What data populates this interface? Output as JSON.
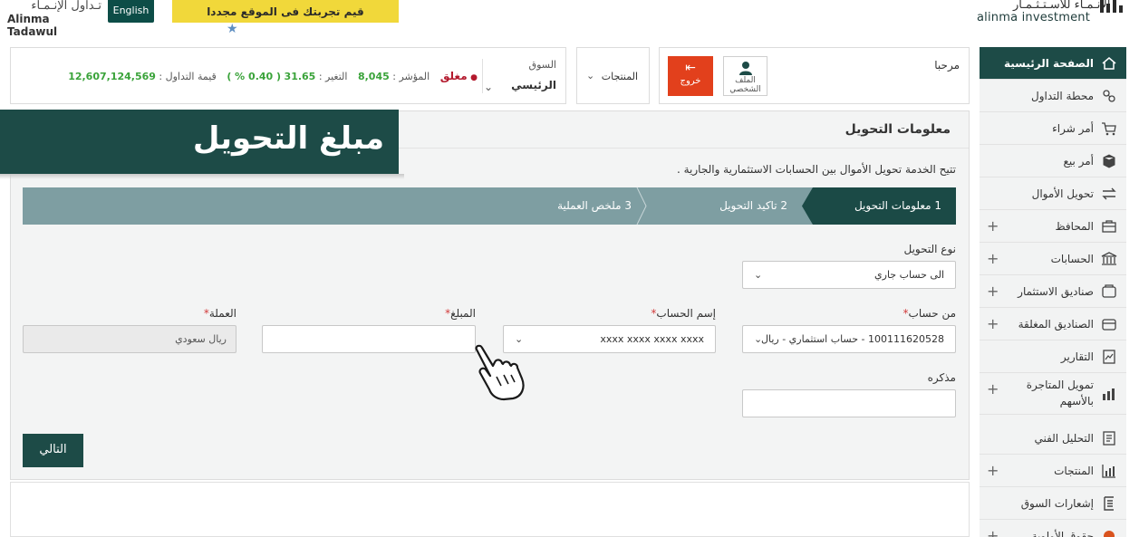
{
  "header": {
    "left_logo_ar": "تـداول الإنـمـاء",
    "left_logo_en": "Alinma Tadawul",
    "lang_button": "English",
    "promo_text": "قيم تجربتك فى الموقع مجددا",
    "right_logo_ar": "الإنـمـاء للاسـتـثـمـار",
    "right_logo_en": "alinma investment"
  },
  "market": {
    "label": "السوق",
    "value": "الرئيسي",
    "status": "مغلق",
    "index_label": "المؤشر :",
    "index_value": "8,045",
    "change_label": "التغير :",
    "change_value": "31.65",
    "change_pct": "( 0.40 % )",
    "turnover_label": "قيمة التداول :",
    "turnover_value": "12,607,124,569"
  },
  "products_menu": {
    "label": "المنتجات"
  },
  "user": {
    "welcome": "مرحبا",
    "profile_label": "الملف الشخصي",
    "logout_label": "خروج"
  },
  "page": {
    "title": "معلومات التحويل",
    "description": "تتيح الخدمة تحويل الأموال بين الحسابات الاستثمارية والجارية .",
    "overlay_caption": "مبلغ التحويل"
  },
  "steps": [
    {
      "label": "1 معلومات التحويل"
    },
    {
      "label": "2 تاكيد التحويل"
    },
    {
      "label": "3 ملخص العملية"
    }
  ],
  "form": {
    "transfer_type": {
      "label": "نوع التحويل",
      "value": "الى حساب جاري"
    },
    "from_account": {
      "label": "من حساب",
      "value": "100111620528 - حساب استثماري - ريال"
    },
    "account_name": {
      "label": "إسم الحساب",
      "value": "xxxx xxxx xxxx xxxx"
    },
    "amount": {
      "label": "المبلغ",
      "value": ""
    },
    "currency": {
      "label": "العملة",
      "value": "ريال سعودي"
    },
    "memo": {
      "label": "مذكره",
      "value": ""
    },
    "required_mark": "*",
    "next_button": "التالي"
  },
  "sidebar": {
    "items": [
      {
        "label": "الصفحة الرئيسية",
        "icon": "home-icon",
        "active": true,
        "expandable": false
      },
      {
        "label": "محطة التداول",
        "icon": "trading-station-icon",
        "active": false,
        "expandable": false
      },
      {
        "label": "أمر شراء",
        "icon": "cart-icon",
        "active": false,
        "expandable": false
      },
      {
        "label": "أمر بيع",
        "icon": "box-icon",
        "active": false,
        "expandable": false
      },
      {
        "label": "تحويل الأموال",
        "icon": "transfer-arrows-icon",
        "active": false,
        "expandable": false
      },
      {
        "label": "المحافظ",
        "icon": "briefcase-icon",
        "active": false,
        "expandable": true
      },
      {
        "label": "الحسابات",
        "icon": "bank-icon",
        "active": false,
        "expandable": true
      },
      {
        "label": "صناديق الاستثمار",
        "icon": "fund-icon",
        "active": false,
        "expandable": true
      },
      {
        "label": "الصناديق المغلقة",
        "icon": "closed-fund-icon",
        "active": false,
        "expandable": true
      },
      {
        "label": "التقارير",
        "icon": "reports-icon",
        "active": false,
        "expandable": false
      },
      {
        "label": "تمويل المتاجرة بالأسهم",
        "icon": "margin-finance-icon",
        "active": false,
        "expandable": true
      },
      {
        "label": "التحليل الفني",
        "icon": "analysis-icon",
        "active": false,
        "expandable": false
      },
      {
        "label": "المنتجات",
        "icon": "products-chart-icon",
        "active": false,
        "expandable": true
      },
      {
        "label": "إشعارات السوق",
        "icon": "notifications-icon",
        "active": false,
        "expandable": false
      },
      {
        "label": "حقوق الأولوية",
        "icon": "rights-icon",
        "active": false,
        "expandable": true
      }
    ],
    "plus_symbol": "+"
  }
}
